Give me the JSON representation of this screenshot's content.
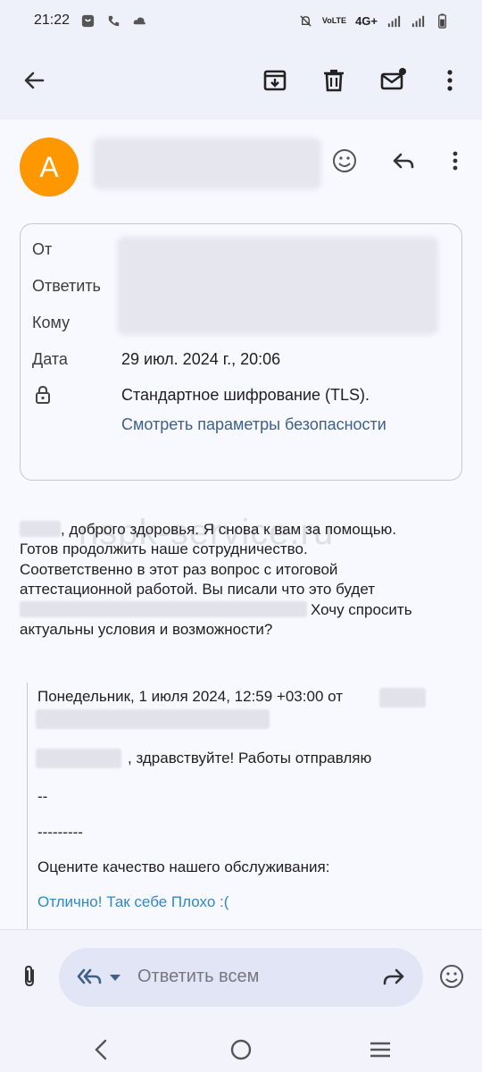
{
  "status_bar": {
    "time": "21:22",
    "network": "4G+"
  },
  "toolbar": {
    "back_icon": "arrow-left-icon",
    "archive_icon": "archive-icon",
    "delete_icon": "trash-icon",
    "mark_unread_icon": "mail-dot-icon",
    "more_icon": "more-vert-icon"
  },
  "sender": {
    "avatar_letter": "A",
    "avatar_color": "#ff9800"
  },
  "details": {
    "from_label": "От",
    "reply_to_label": "Ответить",
    "to_label": "Кому",
    "date_label": "Дата",
    "date_value": "29 июл. 2024 г., 20:06",
    "encryption_value": "Стандартное шифрование (TLS).",
    "security_link": "Смотреть параметры безопасности"
  },
  "message": {
    "line1": ", доброго здоровья. Я снова к вам за помощью.",
    "line2": "Готов продолжить наше сотрудничество.",
    "line3": "Соответственно в этот раз вопрос с итоговой",
    "line4": "аттестационной работой. Вы писали что это будет",
    "line5": "Хочу спросить",
    "line6": "актуальны условия и возможности?"
  },
  "watermark": "nspk-service.ru",
  "quote": {
    "header": "Понедельник, 1 июля 2024, 12:59 +03:00 от",
    "greeting": ", здравствуйте! Работы отправляю",
    "sig1": "--",
    "sig2": "---------",
    "rate": "Оцените качество нашего обслуживания:",
    "rating_links": "Отлично! Так себе Плохо :("
  },
  "compose": {
    "reply_all_placeholder": "Ответить всем"
  },
  "colors": {
    "accent_link": "#3f6189",
    "quote_link": "#2d8ac7",
    "appbar_bg": "#eef0fa"
  }
}
